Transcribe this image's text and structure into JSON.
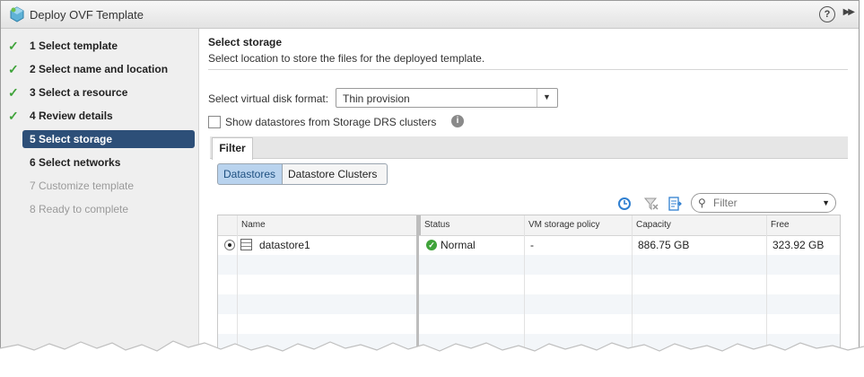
{
  "window": {
    "title": "Deploy OVF Template",
    "help_icon": "help-icon",
    "expand_icon": "expand-icon"
  },
  "steps": [
    {
      "label": "1  Select template",
      "state": "done"
    },
    {
      "label": "2  Select name and location",
      "state": "done"
    },
    {
      "label": "3  Select a resource",
      "state": "done"
    },
    {
      "label": "4  Review details",
      "state": "done"
    },
    {
      "label": "5  Select storage",
      "state": "active"
    },
    {
      "label": "6  Select networks",
      "state": "pending"
    },
    {
      "label": "7  Customize template",
      "state": "disabled"
    },
    {
      "label": "8  Ready to complete",
      "state": "disabled"
    }
  ],
  "page": {
    "title": "Select storage",
    "subtitle": "Select location to store the files for the deployed template."
  },
  "disk_format": {
    "label": "Select virtual disk format:",
    "value": "Thin provision"
  },
  "drs": {
    "label": "Show datastores from Storage DRS clusters",
    "checked": false
  },
  "tabs": {
    "filter": "Filter"
  },
  "segments": {
    "datastores": "Datastores",
    "clusters": "Datastore Clusters"
  },
  "filter": {
    "placeholder": "Filter"
  },
  "table": {
    "columns": [
      "Name",
      "Status",
      "VM storage policy",
      "Capacity",
      "Free"
    ],
    "rows": [
      {
        "name": "datastore1",
        "status": "Normal",
        "policy": "-",
        "capacity": "886.75  GB",
        "free": "323.92  GB",
        "selected": true
      }
    ]
  },
  "colors": {
    "accent": "#2d4f78",
    "check": "#3fa33a",
    "segment_active": "#b9d3ee"
  }
}
